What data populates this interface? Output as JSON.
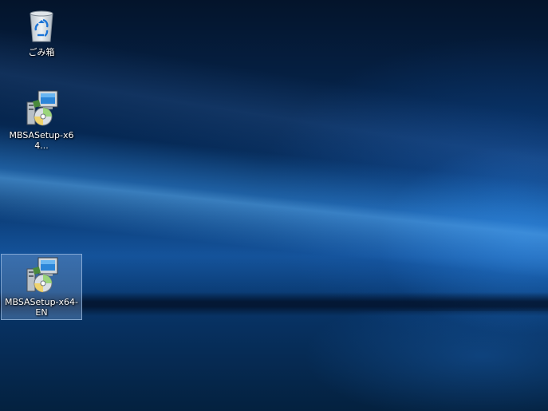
{
  "desktop": {
    "icons": [
      {
        "label": "ごみ箱",
        "icon": "recycle-bin-icon",
        "selected": false
      },
      {
        "label": "MBSASetup-x64...",
        "icon": "installer-package-icon",
        "selected": false
      },
      {
        "label": "MBSASetup-x64-EN",
        "icon": "installer-package-icon",
        "selected": true
      }
    ]
  },
  "colors": {
    "accent": "#1e6fd0",
    "selection": "#6e96c8",
    "label_text": "#ffffff"
  }
}
